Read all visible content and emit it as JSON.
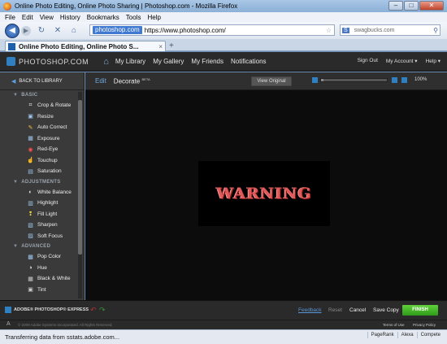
{
  "window": {
    "title": "Online Photo Editing, Online Photo Sharing | Photoshop.com - Mozilla Firefox",
    "buttons": {
      "minimize": "–",
      "maximize": "□",
      "close": "✕"
    }
  },
  "menubar": [
    "File",
    "Edit",
    "View",
    "History",
    "Bookmarks",
    "Tools",
    "Help"
  ],
  "navbar": {
    "site_label": "photoshop.com",
    "url": "https://www.photoshop.com/",
    "search_engine": "S",
    "search_placeholder": "swagbucks.com"
  },
  "tab": {
    "title": "Online Photo Editing, Online Photo S..."
  },
  "app": {
    "logo": "PHOTOSHOP.COM",
    "nav": [
      "My Library",
      "My Gallery",
      "My Friends",
      "Notifications"
    ],
    "right": [
      "Sign Out",
      "My Account ▾",
      "Help ▾"
    ]
  },
  "sidebar": {
    "back": "BACK TO LIBRARY",
    "sections": [
      {
        "title": "BASIC",
        "tools": [
          {
            "label": "Crop & Rotate",
            "icon": "crop-icon",
            "glyph": "⌗",
            "color": "#e8e8e8"
          },
          {
            "label": "Resize",
            "icon": "resize-icon",
            "glyph": "▣",
            "color": "#9fc6ee"
          },
          {
            "label": "Auto Correct",
            "icon": "wand-icon",
            "glyph": "✎",
            "color": "#f0c040"
          },
          {
            "label": "Exposure",
            "icon": "exposure-icon",
            "glyph": "▦",
            "color": "#9fc6ee"
          },
          {
            "label": "Red-Eye",
            "icon": "red-eye-icon",
            "glyph": "◉",
            "color": "#ff5050"
          },
          {
            "label": "Touchup",
            "icon": "touchup-icon",
            "glyph": "☝",
            "color": "#f0d0a0"
          },
          {
            "label": "Saturation",
            "icon": "saturation-icon",
            "glyph": "▤",
            "color": "#9fc6ee"
          }
        ]
      },
      {
        "title": "ADJUSTMENTS",
        "tools": [
          {
            "label": "White Balance",
            "icon": "white-balance-icon",
            "glyph": "◐",
            "color": "#e8e8e8"
          },
          {
            "label": "Highlight",
            "icon": "highlight-icon",
            "glyph": "▥",
            "color": "#9fc6ee"
          },
          {
            "label": "Fill Light",
            "icon": "fill-light-icon",
            "glyph": "❢",
            "color": "#f0d040"
          },
          {
            "label": "Sharpen",
            "icon": "sharpen-icon",
            "glyph": "▧",
            "color": "#9fc6ee"
          },
          {
            "label": "Soft Focus",
            "icon": "soft-focus-icon",
            "glyph": "▨",
            "color": "#9fc6ee"
          }
        ]
      },
      {
        "title": "ADVANCED",
        "tools": [
          {
            "label": "Pop Color",
            "icon": "pop-color-icon",
            "glyph": "▩",
            "color": "#9fc6ee"
          },
          {
            "label": "Hue",
            "icon": "hue-icon",
            "glyph": "◑",
            "color": "#e8e8e8"
          },
          {
            "label": "Black & White",
            "icon": "black-white-icon",
            "glyph": "▦",
            "color": "#cccccc"
          },
          {
            "label": "Tint",
            "icon": "tint-icon",
            "glyph": "▣",
            "color": "#cccccc"
          }
        ]
      }
    ]
  },
  "editor": {
    "edit_tab": "Edit",
    "decorate_tab": "Decorate",
    "beta": "BETA",
    "view_original": "View Original",
    "zoom_level": "100%",
    "zoom_fraction": 0.04,
    "photo_text": "WARNING"
  },
  "bottom": {
    "logo": "ADOBE® PHOTOSHOP® EXPRESS",
    "feedback": "Feedback",
    "reset": "Reset",
    "cancel": "Cancel",
    "save_copy": "Save Copy",
    "finish": "FINISH"
  },
  "footer": {
    "copyright": "© 2009 Adobe Systems Incorporated. All Rights Reserved.",
    "terms": "Terms of Use",
    "privacy": "Privacy Policy"
  },
  "status": {
    "text": "Transferring data from sstats.adobe.com...",
    "addons": [
      "PageRank",
      "Alexa",
      "Compete"
    ]
  },
  "colors": {
    "finish": "#3fb52a",
    "accent": "#2f7fc1"
  }
}
